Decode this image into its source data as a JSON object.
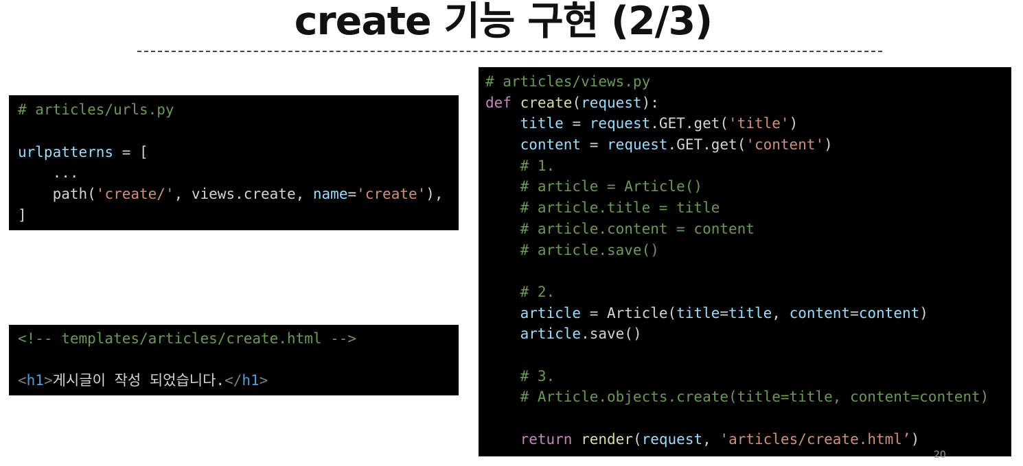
{
  "slide": {
    "title": "create 기능 구현 (2/3)",
    "page_number": "20"
  },
  "urls_code": {
    "l1": "# articles/urls.py",
    "l3_var": "urlpatterns",
    "l3_rest": " = [",
    "l4": "    ...",
    "l5_a": "    path(",
    "l5_str1": "'create/'",
    "l5_b": ", views.create, ",
    "l5_kw": "name",
    "l5_eq": "=",
    "l5_str2": "'create'",
    "l5_end": "),",
    "l6": "]"
  },
  "html_code": {
    "comment": "<!-- templates/articles/create.html -->",
    "open_lt": "<",
    "open_tag": "h1",
    "open_gt": ">",
    "text": "게시글이 작성 되었습니다.",
    "close_lt": "</",
    "close_tag": "h1",
    "close_gt": ">"
  },
  "views_code": {
    "l1": "# articles/views.py",
    "l2_def": "def",
    "l2_fn": "create",
    "l2_p1": "(",
    "l2_param": "request",
    "l2_p2": "):",
    "l3_indent": "    ",
    "l3_var": "title",
    "l3_eq": " = ",
    "l3_req": "request",
    "l3_call": ".GET.get(",
    "l3_str": "'title'",
    "l3_end": ")",
    "l4_var": "content",
    "l4_str": "'content'",
    "c1": "    # 1.",
    "c2": "    # article = Article()",
    "c3": "    # article.title = title",
    "c4": "    # article.content = content",
    "c5": "    # article.save()",
    "c6": "    # 2.",
    "l12_var": "article",
    "l12_call": "Article(",
    "l12_k1": "title",
    "l12_eq": "=",
    "l12_v1": "title",
    "l12_sep": ", ",
    "l12_k2": "content",
    "l12_v2": "content",
    "l12_end": ")",
    "l13_var": "article",
    "l13_call": ".save()",
    "c7": "    # 3.",
    "c8": "    # Article.objects.create(title=title, content=content)",
    "l18_kw": "return",
    "l18_fn": "render",
    "l18_p1": "(",
    "l18_param": "request",
    "l18_sep": ", ",
    "l18_str": "'articles/create.html’",
    "l18_end": ")"
  },
  "colors": {
    "panel_bg": "#000000",
    "comment": "#6a9955",
    "keyword": "#c586c0",
    "function": "#dcdcaa",
    "variable": "#9cdcfe",
    "string": "#ce9178",
    "plain": "#d4d4d4",
    "tag": "#569cd6"
  }
}
